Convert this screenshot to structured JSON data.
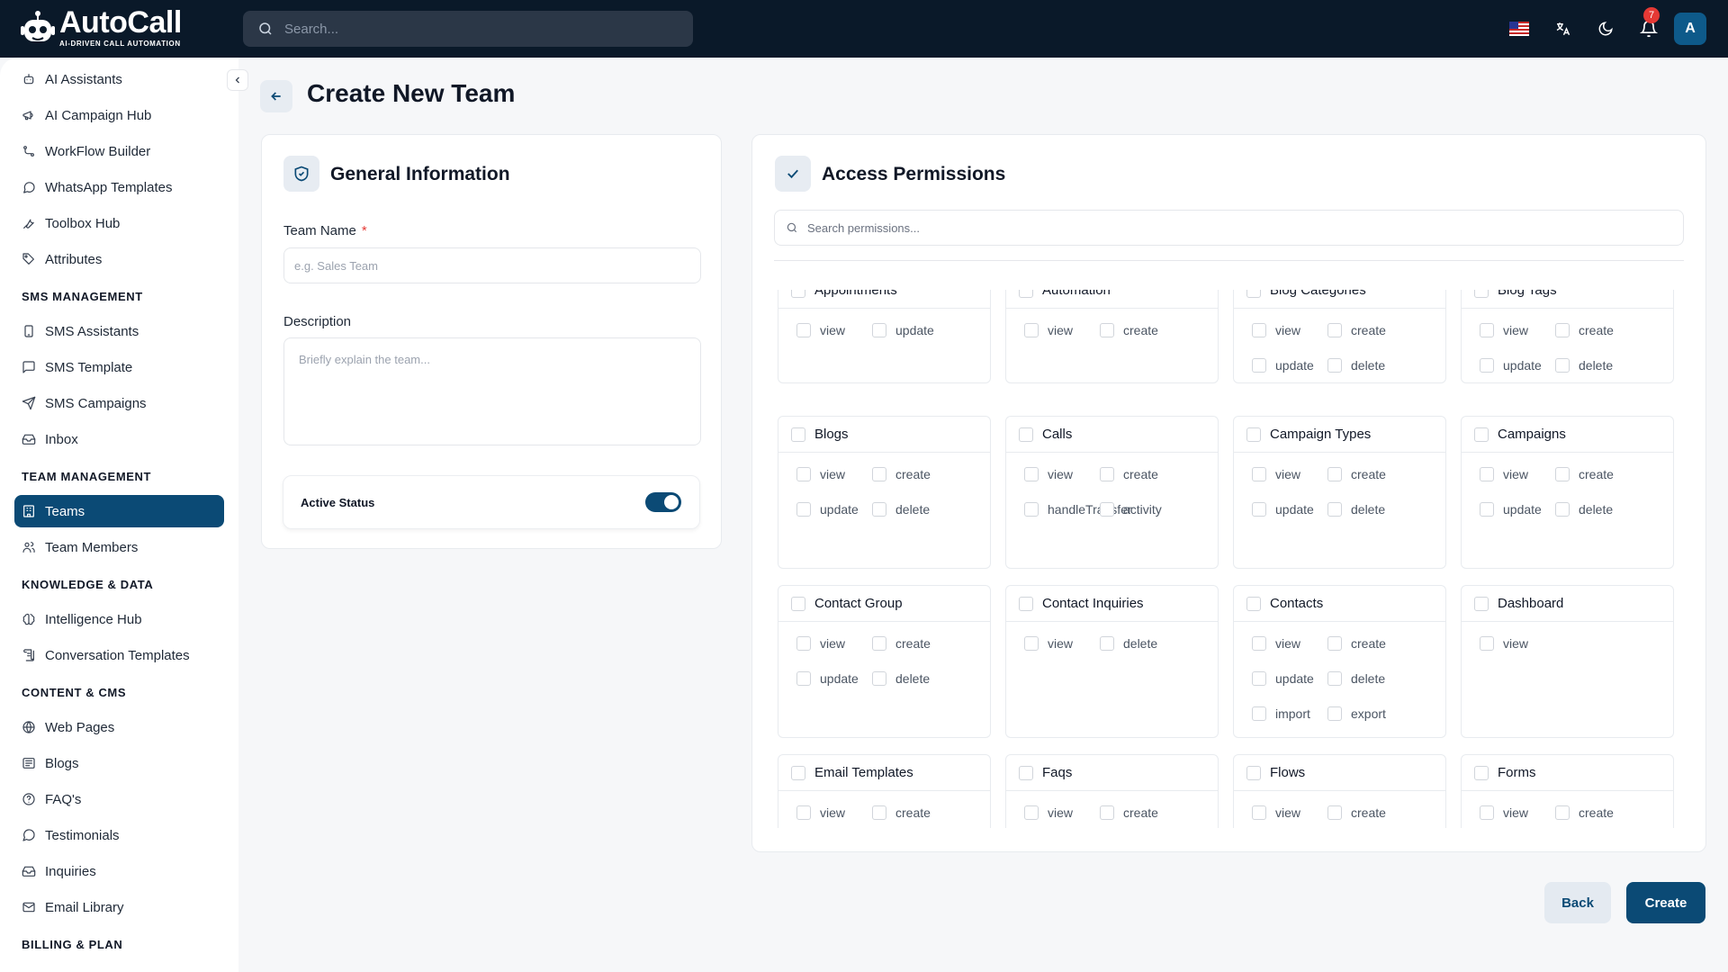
{
  "app": {
    "name": "AutoCall",
    "tagline": "AI-DRIVEN CALL AUTOMATION",
    "search_placeholder": "Search...",
    "notification_count": "7",
    "avatar_initial": "A"
  },
  "sidebar": {
    "items_top": [
      {
        "label": "AI Assistants",
        "icon": "robot-icon"
      },
      {
        "label": "AI Campaign Hub",
        "icon": "megaphone-icon"
      },
      {
        "label": "WorkFlow Builder",
        "icon": "workflow-icon"
      },
      {
        "label": "WhatsApp Templates",
        "icon": "chat-bubble-icon"
      },
      {
        "label": "Toolbox Hub",
        "icon": "wrench-icon"
      },
      {
        "label": "Attributes",
        "icon": "tag-icon"
      }
    ],
    "sms_section": "SMS MANAGEMENT",
    "sms_items": [
      {
        "label": "SMS Assistants",
        "icon": "phone-icon"
      },
      {
        "label": "SMS Template",
        "icon": "message-square-icon"
      },
      {
        "label": "SMS Campaigns",
        "icon": "send-icon"
      },
      {
        "label": "Inbox",
        "icon": "inbox-icon"
      }
    ],
    "team_section": "TEAM MANAGEMENT",
    "team_items": [
      {
        "label": "Teams",
        "icon": "building-icon",
        "active": true
      },
      {
        "label": "Team Members",
        "icon": "users-icon"
      }
    ],
    "knowledge_section": "KNOWLEDGE & DATA",
    "knowledge_items": [
      {
        "label": "Intelligence Hub",
        "icon": "brain-icon"
      },
      {
        "label": "Conversation Templates",
        "icon": "scroll-icon"
      }
    ],
    "content_section": "CONTENT & CMS",
    "content_items": [
      {
        "label": "Web Pages",
        "icon": "globe-icon"
      },
      {
        "label": "Blogs",
        "icon": "newspaper-icon"
      },
      {
        "label": "FAQ's",
        "icon": "help-circle-icon"
      },
      {
        "label": "Testimonials",
        "icon": "message-circle-icon"
      },
      {
        "label": "Inquiries",
        "icon": "inbox-icon"
      },
      {
        "label": "Email Library",
        "icon": "mail-icon"
      }
    ],
    "billing_section": "BILLING & PLAN"
  },
  "page": {
    "title": "Create New Team"
  },
  "general": {
    "title": "General Information",
    "team_name_label": "Team Name",
    "required_mark": "*",
    "team_name_placeholder": "e.g. Sales Team",
    "description_label": "Description",
    "description_placeholder": "Briefly explain the team...",
    "active_status_label": "Active Status",
    "active": true
  },
  "permissions": {
    "title": "Access Permissions",
    "search_placeholder": "Search permissions...",
    "groups": [
      {
        "name": "Appointments",
        "actions": [
          "view",
          "update"
        ]
      },
      {
        "name": "Automation",
        "actions": [
          "view",
          "create"
        ]
      },
      {
        "name": "Blog Categories",
        "actions": [
          "view",
          "create",
          "update",
          "delete"
        ]
      },
      {
        "name": "Blog Tags",
        "actions": [
          "view",
          "create",
          "update",
          "delete"
        ]
      },
      {
        "name": "Blogs",
        "actions": [
          "view",
          "create",
          "update",
          "delete"
        ]
      },
      {
        "name": "Calls",
        "actions": [
          "view",
          "create",
          "handleTransfer",
          "activity"
        ]
      },
      {
        "name": "Campaign Types",
        "actions": [
          "view",
          "create",
          "update",
          "delete"
        ]
      },
      {
        "name": "Campaigns",
        "actions": [
          "view",
          "create",
          "update",
          "delete"
        ]
      },
      {
        "name": "Contact Group",
        "actions": [
          "view",
          "create",
          "update",
          "delete"
        ]
      },
      {
        "name": "Contact Inquiries",
        "actions": [
          "view",
          "delete"
        ]
      },
      {
        "name": "Contacts",
        "actions": [
          "view",
          "create",
          "update",
          "delete",
          "import",
          "export"
        ]
      },
      {
        "name": "Dashboard",
        "actions": [
          "view"
        ]
      },
      {
        "name": "Email Templates",
        "actions": [
          "view",
          "create"
        ]
      },
      {
        "name": "Faqs",
        "actions": [
          "view",
          "create"
        ]
      },
      {
        "name": "Flows",
        "actions": [
          "view",
          "create"
        ]
      },
      {
        "name": "Forms",
        "actions": [
          "view",
          "create"
        ]
      }
    ]
  },
  "actions": {
    "back_label": "Back",
    "create_label": "Create"
  },
  "colors": {
    "topbar": "#0a1929",
    "primary": "#0b4a75",
    "badge": "#e53935"
  }
}
